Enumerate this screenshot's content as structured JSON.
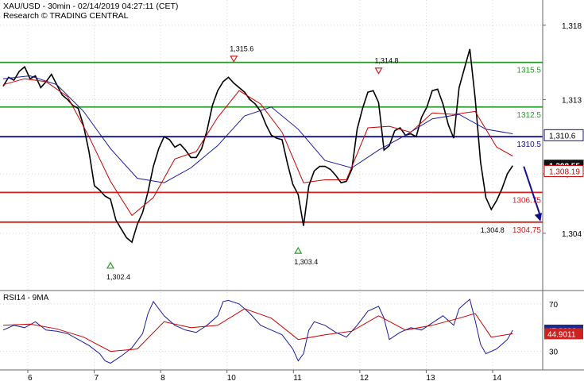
{
  "header": {
    "symbol_line": "XAU/USD - 30min - 02/14/2019 04:27:11 (CET)",
    "source_line": "Research © TRADING CENTRAL"
  },
  "colors": {
    "price": "#000000",
    "fast_ma": "#cc0000",
    "slow_ma": "#1a1aa0",
    "resistance": "#2a9a2a",
    "pivot": "#10108a",
    "support": "#d42020",
    "arrow": "#10108a",
    "rsi": "#1a1aa0",
    "rsi_ma": "#cc0000",
    "current_price_box": "#111111",
    "rsi_value_box": "#1e2a8c",
    "rsi_ma_box": "#cc2222"
  },
  "chart_data": [
    {
      "type": "line",
      "name": "XAU/USD 30min price",
      "x_tick_labels": [
        "6",
        "7",
        "8",
        "10",
        "11",
        "12",
        "13",
        "14"
      ],
      "y_tick_labels": [
        "1,318",
        "1,313",
        "1,308",
        "1,304"
      ],
      "y_ticks": [
        1318,
        1313,
        1308,
        1304
      ],
      "ylim": [
        1300.2,
        1319.7
      ],
      "xlim": [
        0,
        100
      ],
      "close_path": [
        [
          0,
          1313.9
        ],
        [
          1,
          1314.5
        ],
        [
          2,
          1314.3
        ],
        [
          3,
          1314.9
        ],
        [
          4,
          1315.2
        ],
        [
          5,
          1314.4
        ],
        [
          6,
          1314.6
        ],
        [
          7,
          1313.8
        ],
        [
          8,
          1314.2
        ],
        [
          9,
          1314.7
        ],
        [
          10,
          1314.0
        ],
        [
          11,
          1313.3
        ],
        [
          12,
          1313.0
        ],
        [
          13,
          1312.6
        ],
        [
          14,
          1312.4
        ],
        [
          15,
          1311.2
        ],
        [
          16,
          1309.5
        ],
        [
          17,
          1307.2
        ],
        [
          18,
          1306.9
        ],
        [
          19,
          1306.5
        ],
        [
          20,
          1306.3
        ],
        [
          21,
          1304.9
        ],
        [
          22,
          1304.3
        ],
        [
          23,
          1303.7
        ],
        [
          24,
          1303.4
        ],
        [
          25,
          1304.6
        ],
        [
          26,
          1305.4
        ],
        [
          27,
          1306.8
        ],
        [
          28,
          1308.5
        ],
        [
          29,
          1309.7
        ],
        [
          30,
          1310.5
        ],
        [
          31,
          1310.3
        ],
        [
          32,
          1309.8
        ],
        [
          33,
          1310.0
        ],
        [
          34,
          1309.6
        ],
        [
          35,
          1309.1
        ],
        [
          36,
          1309.1
        ],
        [
          37,
          1309.7
        ],
        [
          38,
          1310.9
        ],
        [
          39,
          1312.6
        ],
        [
          40,
          1313.6
        ],
        [
          41,
          1314.2
        ],
        [
          42,
          1314.5
        ],
        [
          43,
          1314.1
        ],
        [
          44,
          1313.8
        ],
        [
          45,
          1313.5
        ],
        [
          46,
          1313.0
        ],
        [
          47,
          1312.7
        ],
        [
          48,
          1312.2
        ],
        [
          49,
          1311.3
        ],
        [
          50,
          1310.6
        ],
        [
          51,
          1310.4
        ],
        [
          52,
          1310.3
        ],
        [
          53,
          1308.7
        ],
        [
          54,
          1307.3
        ],
        [
          55,
          1306.6
        ],
        [
          56,
          1304.5
        ],
        [
          57,
          1307.2
        ],
        [
          58,
          1308.2
        ],
        [
          59,
          1308.5
        ],
        [
          60,
          1308.5
        ],
        [
          61,
          1308.3
        ],
        [
          62,
          1307.9
        ],
        [
          63,
          1307.4
        ],
        [
          64,
          1307.5
        ],
        [
          65,
          1308.3
        ],
        [
          66,
          1311.0
        ],
        [
          67,
          1312.4
        ],
        [
          68,
          1313.5
        ],
        [
          69,
          1313.6
        ],
        [
          70,
          1312.8
        ],
        [
          71,
          1309.6
        ],
        [
          72,
          1309.9
        ],
        [
          73,
          1310.9
        ],
        [
          74,
          1311.1
        ],
        [
          75,
          1310.6
        ],
        [
          76,
          1310.7
        ],
        [
          77,
          1310.5
        ],
        [
          78,
          1311.8
        ],
        [
          79,
          1312.5
        ],
        [
          80,
          1313.6
        ],
        [
          81,
          1313.7
        ],
        [
          82,
          1312.7
        ],
        [
          83,
          1311.3
        ],
        [
          84,
          1310.4
        ],
        [
          85,
          1313.8
        ],
        [
          86,
          1315.1
        ],
        [
          87,
          1316.4
        ],
        [
          88,
          1313.1
        ],
        [
          89,
          1308.8
        ],
        [
          90,
          1306.4
        ],
        [
          91,
          1305.6
        ],
        [
          92,
          1306.2
        ],
        [
          93,
          1307.0
        ],
        [
          94,
          1308.0
        ],
        [
          95,
          1308.55
        ]
      ],
      "fast_ma_path": [
        [
          0,
          1314.0
        ],
        [
          4,
          1314.4
        ],
        [
          8,
          1314.2
        ],
        [
          12,
          1313.2
        ],
        [
          16,
          1310.5
        ],
        [
          20,
          1307.5
        ],
        [
          24,
          1305.2
        ],
        [
          28,
          1306.4
        ],
        [
          32,
          1309.0
        ],
        [
          36,
          1309.5
        ],
        [
          40,
          1311.8
        ],
        [
          44,
          1313.6
        ],
        [
          48,
          1312.7
        ],
        [
          52,
          1310.8
        ],
        [
          56,
          1307.4
        ],
        [
          60,
          1307.6
        ],
        [
          64,
          1307.6
        ],
        [
          68,
          1311.1
        ],
        [
          72,
          1311.2
        ],
        [
          76,
          1310.8
        ],
        [
          80,
          1312.1
        ],
        [
          84,
          1312.0
        ],
        [
          88,
          1312.2
        ],
        [
          92,
          1309.8
        ],
        [
          95,
          1309.2
        ]
      ],
      "slow_ma_path": [
        [
          0,
          1314.4
        ],
        [
          5,
          1314.6
        ],
        [
          10,
          1314.0
        ],
        [
          15,
          1312.2
        ],
        [
          20,
          1309.7
        ],
        [
          25,
          1307.7
        ],
        [
          30,
          1307.4
        ],
        [
          35,
          1308.4
        ],
        [
          40,
          1309.9
        ],
        [
          45,
          1311.9
        ],
        [
          50,
          1312.5
        ],
        [
          55,
          1311.0
        ],
        [
          60,
          1308.9
        ],
        [
          65,
          1308.4
        ],
        [
          70,
          1309.6
        ],
        [
          75,
          1310.6
        ],
        [
          80,
          1311.7
        ],
        [
          85,
          1312.0
        ],
        [
          90,
          1311.0
        ],
        [
          95,
          1310.7
        ]
      ],
      "horizontal_levels": [
        {
          "value": 1315.5,
          "label": "1315.5",
          "kind": "resistance"
        },
        {
          "value": 1312.5,
          "label": "1312.5",
          "kind": "resistance"
        },
        {
          "value": 1310.5,
          "label": "1310.5",
          "kind": "pivot"
        },
        {
          "value": 1306.75,
          "label": "1306.75",
          "kind": "support"
        },
        {
          "value": 1304.75,
          "label": "1304.75",
          "kind": "support"
        }
      ],
      "annotations": [
        {
          "label": "1,315.6",
          "x": 43,
          "value": 1315.6,
          "marker": "down-triangle"
        },
        {
          "label": "1,314.8",
          "x": 70,
          "value": 1314.8,
          "marker": "down-triangle"
        },
        {
          "label": "1,302.4",
          "x": 20,
          "value": 1302.4,
          "marker": "up-triangle"
        },
        {
          "label": "1,303.4",
          "x": 55,
          "value": 1303.4,
          "marker": "up-triangle"
        },
        {
          "label": "1,304.8",
          "x": 89,
          "value": 1304.8,
          "marker": "none"
        }
      ],
      "forecast_arrow": {
        "from": [
          95,
          1308.5
        ],
        "to": [
          99,
          1304.8
        ]
      },
      "price_badges": [
        {
          "label": "1,310.6",
          "value": 1310.6,
          "style": "pivot"
        },
        {
          "label": "1,308.55",
          "value": 1308.55,
          "style": "current"
        },
        {
          "label": "1,308.19",
          "value": 1308.19,
          "style": "fast_ma"
        }
      ]
    },
    {
      "type": "line",
      "title": "RSI14 - 9MA",
      "y_tick_labels": [
        "70",
        "30"
      ],
      "y_ticks": [
        70,
        30
      ],
      "ylim": [
        15,
        80
      ],
      "xlim": [
        0,
        100
      ],
      "rsi_path": [
        [
          0,
          48
        ],
        [
          2,
          52
        ],
        [
          4,
          50
        ],
        [
          6,
          55
        ],
        [
          8,
          48
        ],
        [
          10,
          47
        ],
        [
          12,
          45
        ],
        [
          14,
          40
        ],
        [
          16,
          35
        ],
        [
          18,
          28
        ],
        [
          19,
          22
        ],
        [
          20,
          20
        ],
        [
          22,
          26
        ],
        [
          24,
          33
        ],
        [
          26,
          45
        ],
        [
          27,
          62
        ],
        [
          28,
          72
        ],
        [
          30,
          60
        ],
        [
          32,
          52
        ],
        [
          34,
          48
        ],
        [
          36,
          46
        ],
        [
          38,
          52
        ],
        [
          40,
          60
        ],
        [
          41,
          72
        ],
        [
          42,
          73
        ],
        [
          44,
          70
        ],
        [
          46,
          62
        ],
        [
          48,
          52
        ],
        [
          50,
          48
        ],
        [
          52,
          44
        ],
        [
          54,
          32
        ],
        [
          55,
          22
        ],
        [
          56,
          28
        ],
        [
          57,
          48
        ],
        [
          58,
          55
        ],
        [
          60,
          52
        ],
        [
          62,
          46
        ],
        [
          64,
          42
        ],
        [
          66,
          52
        ],
        [
          68,
          64
        ],
        [
          70,
          68
        ],
        [
          71,
          58
        ],
        [
          72,
          40
        ],
        [
          74,
          46
        ],
        [
          76,
          50
        ],
        [
          78,
          48
        ],
        [
          80,
          54
        ],
        [
          82,
          60
        ],
        [
          84,
          52
        ],
        [
          85,
          66
        ],
        [
          86,
          70
        ],
        [
          87,
          74
        ],
        [
          88,
          56
        ],
        [
          89,
          36
        ],
        [
          90,
          28
        ],
        [
          92,
          32
        ],
        [
          94,
          40
        ],
        [
          95,
          47.86
        ]
      ],
      "rsi_ma_path": [
        [
          0,
          52
        ],
        [
          5,
          53
        ],
        [
          10,
          49
        ],
        [
          15,
          42
        ],
        [
          20,
          30
        ],
        [
          25,
          32
        ],
        [
          30,
          55
        ],
        [
          35,
          50
        ],
        [
          40,
          52
        ],
        [
          45,
          66
        ],
        [
          50,
          58
        ],
        [
          55,
          40
        ],
        [
          60,
          44
        ],
        [
          65,
          47
        ],
        [
          70,
          60
        ],
        [
          75,
          48
        ],
        [
          80,
          52
        ],
        [
          85,
          58
        ],
        [
          88,
          62
        ],
        [
          91,
          42
        ],
        [
          95,
          44.9
        ]
      ],
      "value_badges": [
        {
          "label": "47.8606",
          "value": 47.86,
          "style": "rsi"
        },
        {
          "label": "44.9011",
          "value": 44.9,
          "style": "rsi_ma"
        }
      ]
    }
  ]
}
